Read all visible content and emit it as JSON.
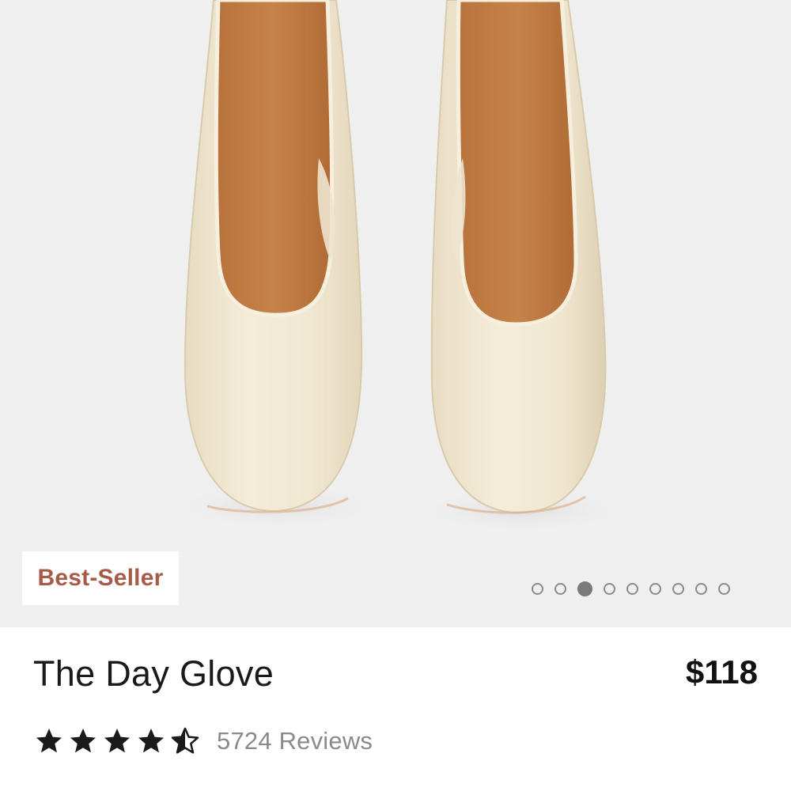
{
  "product": {
    "badge": "Best-Seller",
    "title": "The Day Glove",
    "price": "$118",
    "rating": 4.5,
    "rating_max": 5,
    "reviews_label": "5724 Reviews"
  },
  "gallery": {
    "image_count": 9,
    "active_index": 2
  },
  "colors": {
    "badge_text": "#a65a48",
    "gallery_background": "#efeff0",
    "star": "#1a1a1a",
    "dot_active": "#7a7a7c"
  },
  "icons": {
    "star": "star-icon",
    "half_star": "half-star-icon"
  }
}
